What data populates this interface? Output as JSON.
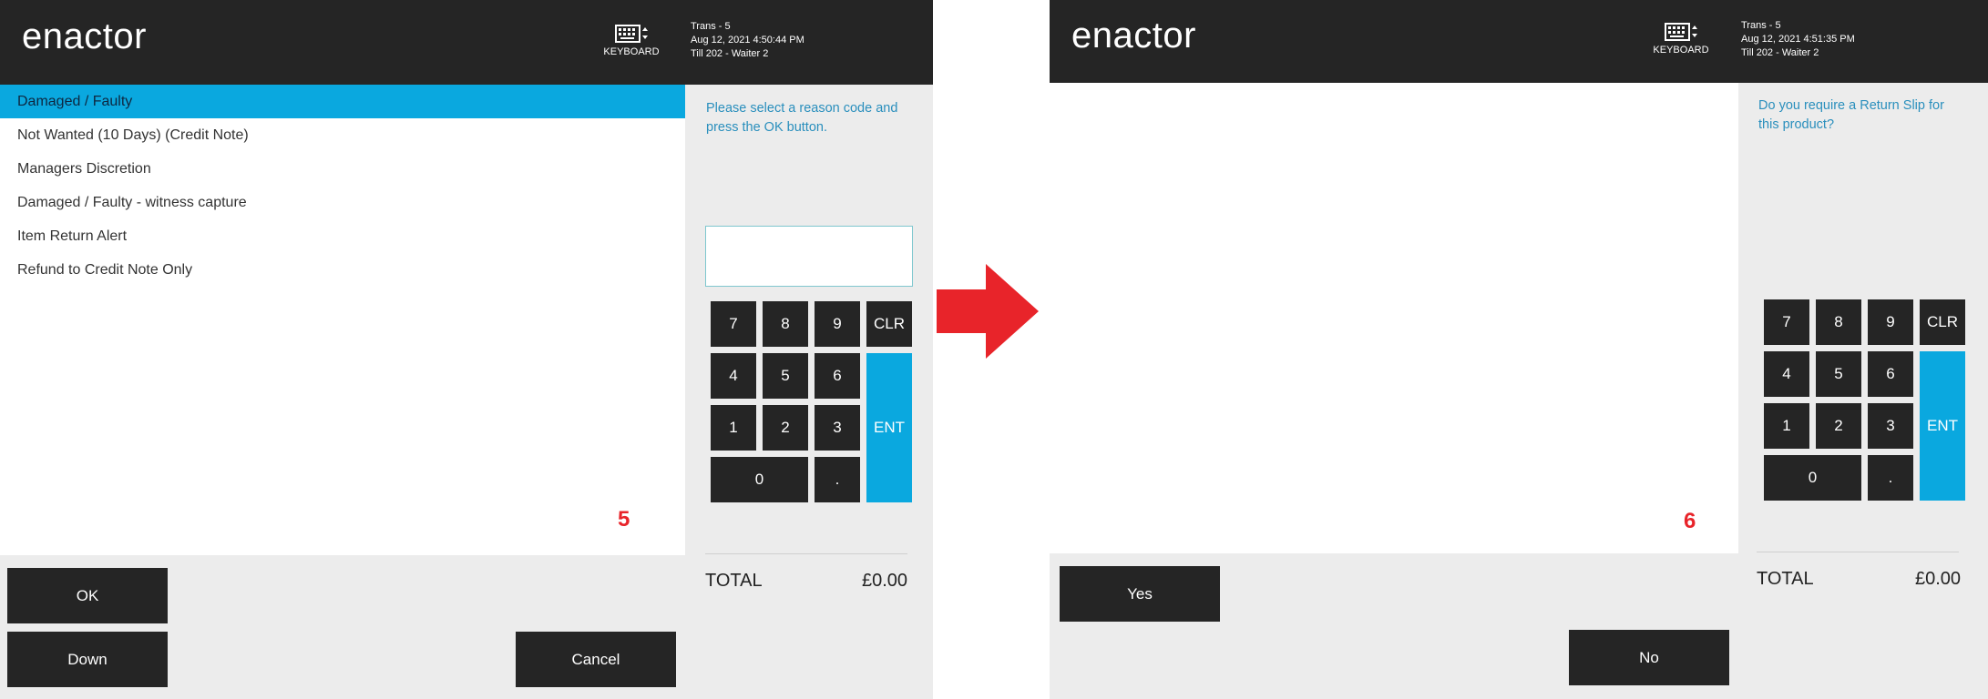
{
  "arrow_color": "#e8242a",
  "left": {
    "logo": "enactor",
    "keyboard_label": "KEYBOARD",
    "trans": {
      "line1": "Trans - 5",
      "line2": "Aug 12, 2021 4:50:44 PM",
      "line3": "Till 202 - Waiter 2"
    },
    "reasons": [
      "Damaged / Faulty",
      "Not Wanted (10 Days) (Credit Note)",
      "Managers Discretion",
      "Damaged / Faulty - witness capture",
      "Item Return Alert",
      "Refund to Credit Note Only"
    ],
    "selected_index": 0,
    "step": "5",
    "prompt": "Please select a reason code and press the OK button.",
    "buttons": {
      "ok": "OK",
      "down": "Down",
      "cancel": "Cancel"
    },
    "keys": [
      "7",
      "8",
      "9",
      "CLR",
      "4",
      "5",
      "6",
      "ENT",
      "1",
      "2",
      "3",
      "0",
      "."
    ],
    "total_label": "TOTAL",
    "total_value": "£0.00"
  },
  "right": {
    "logo": "enactor",
    "keyboard_label": "KEYBOARD",
    "trans": {
      "line1": "Trans - 5",
      "line2": "Aug 12, 2021 4:51:35 PM",
      "line3": "Till 202 - Waiter 2"
    },
    "step": "6",
    "prompt": "Do you require a Return Slip for this product?",
    "buttons": {
      "yes": "Yes",
      "no": "No"
    },
    "keys": [
      "7",
      "8",
      "9",
      "CLR",
      "4",
      "5",
      "6",
      "ENT",
      "1",
      "2",
      "3",
      "0",
      "."
    ],
    "total_label": "TOTAL",
    "total_value": "£0.00"
  }
}
